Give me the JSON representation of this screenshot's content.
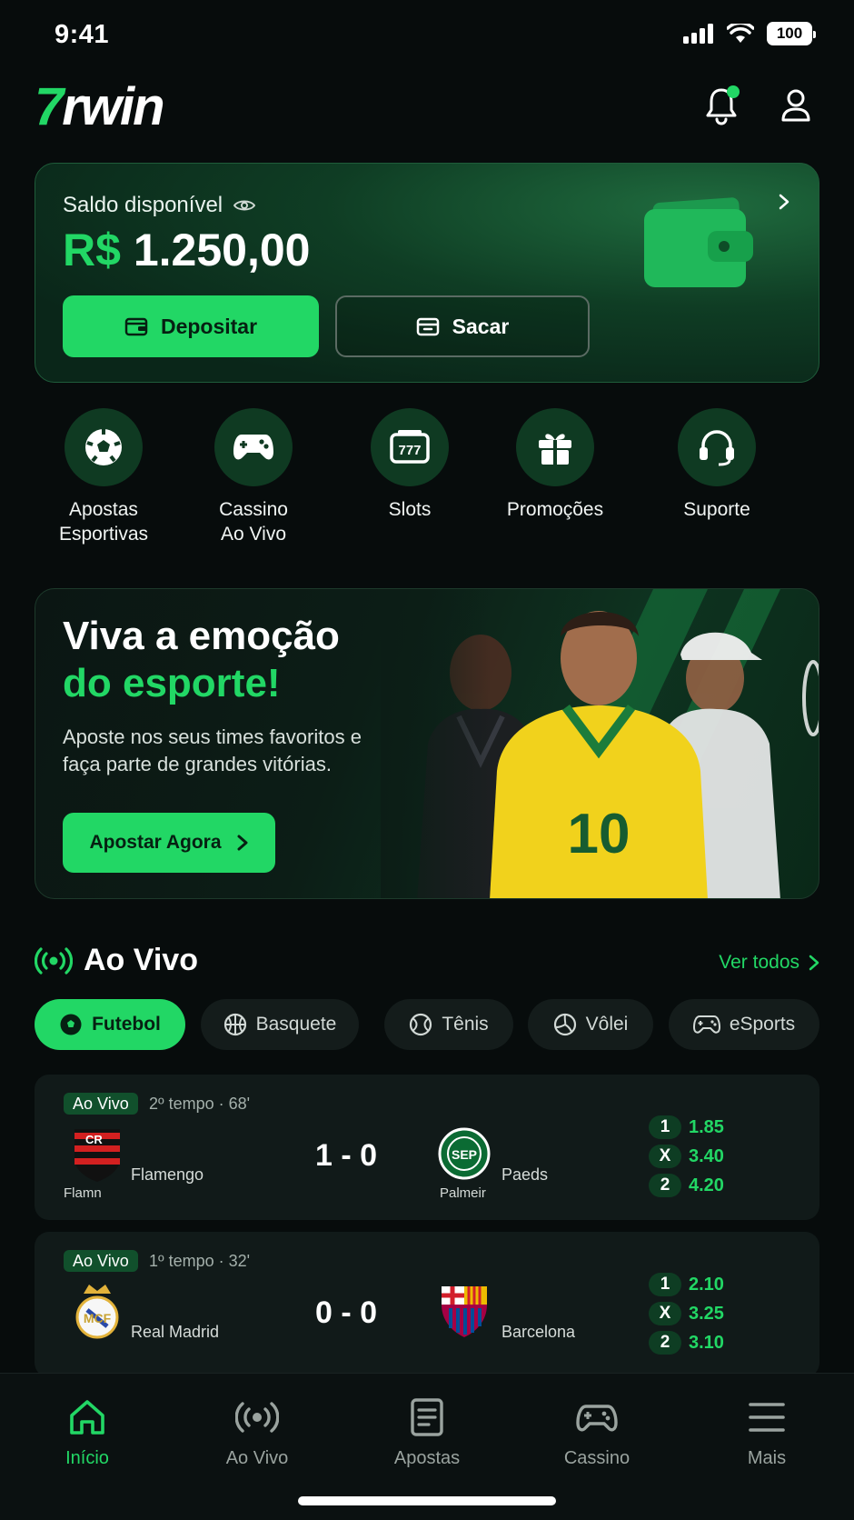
{
  "status_bar": {
    "time": "9:41",
    "battery": "100"
  },
  "header": {
    "logo_prefix": "7",
    "logo_text": "rwin"
  },
  "balance": {
    "label": "Saldo disponível",
    "currency": "R$",
    "amount": "1.250,00",
    "deposit_label": "Depositar",
    "withdraw_label": "Sacar"
  },
  "quick_actions": [
    {
      "label_1": "Apostas",
      "label_2": "Esportivas",
      "icon": "soccer-ball-icon"
    },
    {
      "label_1": "Cassino",
      "label_2": "Ao Vivo",
      "icon": "gamepad-icon"
    },
    {
      "label_1": "Slots",
      "label_2": "",
      "icon": "slot-machine-icon"
    },
    {
      "label_1": "Promoções",
      "label_2": "",
      "icon": "gift-icon"
    },
    {
      "label_1": "Suporte",
      "label_2": "",
      "icon": "headset-icon"
    }
  ],
  "promo": {
    "title_line1": "Viva a emoção",
    "title_line2": "do esporte!",
    "subtitle": "Aposte nos seus times favoritos e faça parte de grandes vitórias.",
    "cta": "Apostar Agora",
    "jersey_number": "10"
  },
  "live": {
    "title": "Ao Vivo",
    "see_all": "Ver todos",
    "tabs": [
      {
        "label": "Futebol",
        "icon": "soccer-ball-icon"
      },
      {
        "label": "Basquete",
        "icon": "basketball-icon"
      },
      {
        "label": "Tênis",
        "icon": "tennis-ball-icon"
      },
      {
        "label": "Vôlei",
        "icon": "volleyball-icon"
      },
      {
        "label": "eSports",
        "icon": "gamepad-icon"
      }
    ],
    "matches": [
      {
        "badge": "Ao Vivo",
        "period": "2º tempo · 68'",
        "home": "Flamengo",
        "home_sub": "Flamn",
        "away": "Paeds",
        "away_sub": "Palmeir",
        "score": "1 - 0",
        "odds": [
          {
            "key": "1",
            "value": "1.85"
          },
          {
            "key": "X",
            "value": "3.40"
          },
          {
            "key": "2",
            "value": "4.20"
          }
        ]
      },
      {
        "badge": "Ao Vivo",
        "period": "1º tempo · 32'",
        "home": "Real Madrid",
        "home_sub": "",
        "away": "Barcelona",
        "away_sub": "",
        "score": "0 - 0",
        "odds": [
          {
            "key": "1",
            "value": "2.10"
          },
          {
            "key": "X",
            "value": "3.25"
          },
          {
            "key": "2",
            "value": "3.10"
          }
        ]
      }
    ]
  },
  "bottom_nav": [
    {
      "label": "Início",
      "icon": "home-icon",
      "active": true
    },
    {
      "label": "Ao Vivo",
      "icon": "live-broadcast-icon",
      "active": false
    },
    {
      "label": "Apostas",
      "icon": "bet-slip-icon",
      "active": false
    },
    {
      "label": "Cassino",
      "icon": "gamepad-icon",
      "active": false
    },
    {
      "label": "Mais",
      "icon": "menu-icon",
      "active": false
    }
  ],
  "colors": {
    "accent": "#22d765",
    "background": "#070c0c",
    "card": "#111a19"
  }
}
